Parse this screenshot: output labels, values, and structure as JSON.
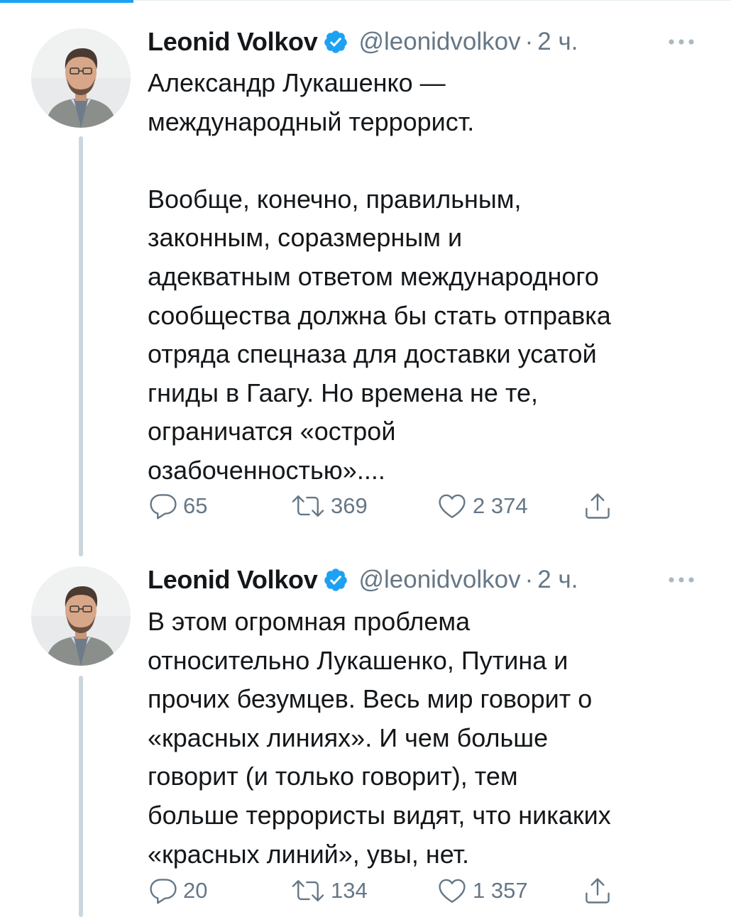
{
  "tweets": [
    {
      "author": {
        "name": "Leonid Volkov",
        "handle": "@leonidvolkov",
        "verified": true
      },
      "separator": "·",
      "time": "2 ч.",
      "text": "Александр Лукашенко —\nмеждународный террорист.\n\nВообще, конечно, правильным,\nзаконным, соразмерным и\nадекватным ответом международного\nсообщества должна бы стать отправка\nотряда спецназа для доставки усатой\nгниды в Гаагу. Но времена не те,\nограничатся «острой\nозабоченностью»....",
      "replies": "65",
      "retweets": "369",
      "likes": "2 374"
    },
    {
      "author": {
        "name": "Leonid Volkov",
        "handle": "@leonidvolkov",
        "verified": true
      },
      "separator": "·",
      "time": "2 ч.",
      "text": "В этом огромная проблема\nотносительно Лукашенко, Путина и\nпрочих безумцев. Весь мир говорит о\n«красных линиях». И чем больше\nговорит (и только говорит), тем\nбольше террористы видят, что никаких\n«красных линий», увы, нет.",
      "replies": "20",
      "retweets": "134",
      "likes": "1 357"
    }
  ],
  "icons": {
    "verified": "verified-badge-icon",
    "more": "more-dots-icon",
    "reply": "reply-bubble-icon",
    "retweet": "retweet-arrows-icon",
    "like": "heart-icon",
    "share": "share-arrow-icon"
  },
  "colors": {
    "accent": "#1da1f2",
    "text": "#14171a",
    "secondary": "#657786",
    "thread_line": "#ccd6dd"
  }
}
